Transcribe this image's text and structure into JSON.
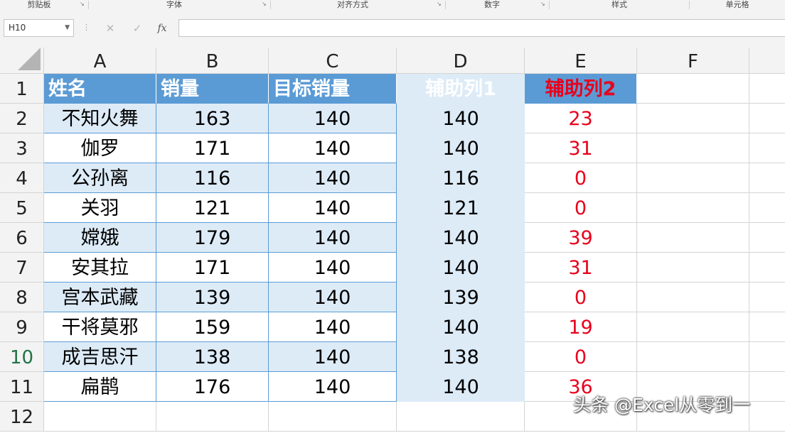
{
  "ribbon": {
    "groups": [
      "剪贴板",
      "字体",
      "对齐方式",
      "数字",
      "样式",
      "单元格"
    ]
  },
  "formula_bar": {
    "name_box": "H10",
    "cancel_icon": "✕",
    "enter_icon": "✓",
    "fx_label": "fx",
    "formula": ""
  },
  "columns": [
    "A",
    "B",
    "C",
    "D",
    "E",
    "F"
  ],
  "row_numbers": [
    "1",
    "2",
    "3",
    "4",
    "5",
    "6",
    "7",
    "8",
    "9",
    "10",
    "11",
    "12"
  ],
  "selected_row": "10",
  "table": {
    "headers": [
      "姓名",
      "销量",
      "目标销量",
      "辅助列1",
      "辅助列2"
    ],
    "rows": [
      [
        "不知火舞",
        "163",
        "140",
        "140",
        "23"
      ],
      [
        "伽罗",
        "171",
        "140",
        "140",
        "31"
      ],
      [
        "公孙离",
        "116",
        "140",
        "116",
        "0"
      ],
      [
        "关羽",
        "121",
        "140",
        "121",
        "0"
      ],
      [
        "嫦娥",
        "179",
        "140",
        "140",
        "39"
      ],
      [
        "安其拉",
        "171",
        "140",
        "140",
        "31"
      ],
      [
        "宫本武藏",
        "139",
        "140",
        "139",
        "0"
      ],
      [
        "干将莫邪",
        "159",
        "140",
        "140",
        "19"
      ],
      [
        "成吉思汗",
        "138",
        "140",
        "138",
        "0"
      ],
      [
        "扁鹊",
        "176",
        "140",
        "140",
        "36"
      ]
    ]
  },
  "colors": {
    "header_fill": "#5b9bd5",
    "band_fill": "#ddebf7",
    "accent_red": "#e8001c",
    "selected_row_header": "#217346"
  },
  "watermark": "头条 @Excel从零到一"
}
